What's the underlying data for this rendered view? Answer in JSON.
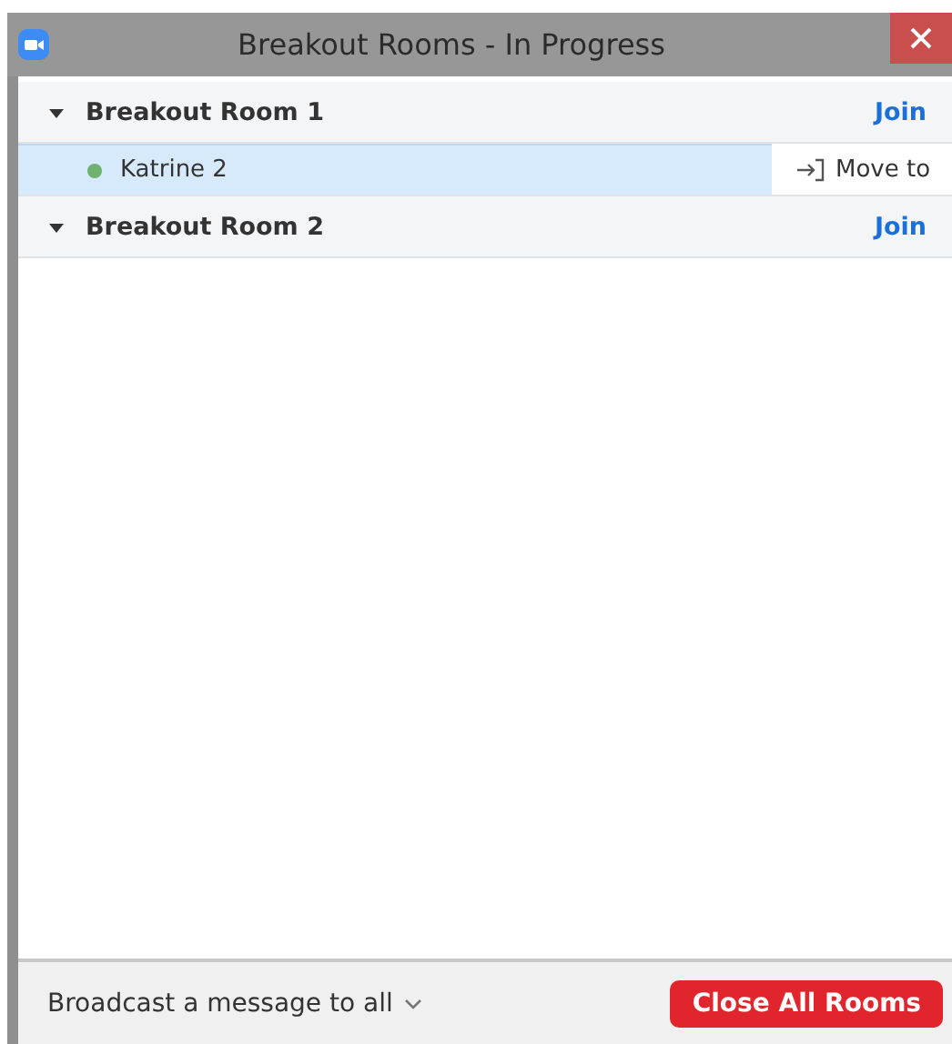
{
  "window": {
    "title": "Breakout Rooms - In Progress"
  },
  "rooms": [
    {
      "name": "Breakout Room 1",
      "expanded": true,
      "join": "Join",
      "participants": [
        {
          "name": "Katrine 2",
          "color": "#6db36d",
          "selected": true,
          "action": "Move to"
        }
      ]
    },
    {
      "name": "Breakout Room 2",
      "expanded": true,
      "join": "Join"
    }
  ],
  "footer": {
    "broadcast": "Broadcast a message to all",
    "close_all": "Close All Rooms"
  }
}
